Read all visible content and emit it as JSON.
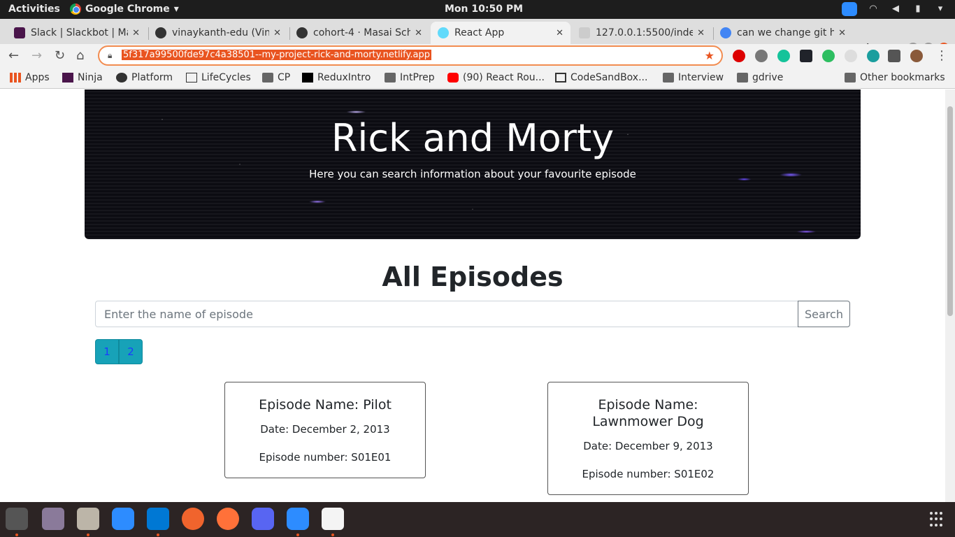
{
  "system": {
    "activities": "Activities",
    "app_menu": "Google Chrome",
    "clock": "Mon 10:50 PM"
  },
  "tabs": [
    {
      "title": "Slack | Slackbot | Ma",
      "favicon_color": "#4a154b"
    },
    {
      "title": "vinaykanth-edu (Vin",
      "favicon_color": "#333333"
    },
    {
      "title": "cohort-4 · Masai Sch",
      "favicon_color": "#333333"
    },
    {
      "title": "React App",
      "favicon_color": "#61dafb",
      "active": true
    },
    {
      "title": "127.0.0.1:5500/index",
      "favicon_color": "#cccccc"
    },
    {
      "title": "can we change git h",
      "favicon_color": "#4285f4"
    }
  ],
  "address_bar": {
    "url": "5f317a99500fde97c4a38501--my-project-rick-and-morty.netlify.app"
  },
  "bookmarks": [
    {
      "label": "Apps",
      "icon": "apps-grid-icon"
    },
    {
      "label": "Ninja",
      "icon": "slack-icon"
    },
    {
      "label": "Platform",
      "icon": "globe-icon"
    },
    {
      "label": "LifeCycles",
      "icon": "book-icon"
    },
    {
      "label": "CP",
      "icon": "folder-icon"
    },
    {
      "label": "ReduxIntro",
      "icon": "medium-icon"
    },
    {
      "label": "IntPrep",
      "icon": "folder-icon"
    },
    {
      "label": "(90) React Rou...",
      "icon": "youtube-icon"
    },
    {
      "label": "CodeSandBox...",
      "icon": "codesandbox-icon"
    },
    {
      "label": "Interview",
      "icon": "folder-icon"
    },
    {
      "label": "gdrive",
      "icon": "folder-icon"
    },
    {
      "label": "Other bookmarks",
      "icon": "folder-icon"
    }
  ],
  "hero": {
    "title": "Rick and Morty",
    "subtitle": "Here you can search information about your favourite episode"
  },
  "main": {
    "heading": "All Episodes",
    "search_placeholder": "Enter the name of episode",
    "search_button": "Search",
    "pages": [
      "1",
      "2"
    ]
  },
  "episodes": [
    {
      "name": "Episode Name: Pilot",
      "date": "Date: December 2, 2013",
      "number": "Episode number: S01E01"
    },
    {
      "name": "Episode Name: Lawnmower Dog",
      "date": "Date: December 9, 2013",
      "number": "Episode number: S01E02"
    }
  ],
  "colors": {
    "accent": "#e95420",
    "pager": "#17a2b8"
  }
}
